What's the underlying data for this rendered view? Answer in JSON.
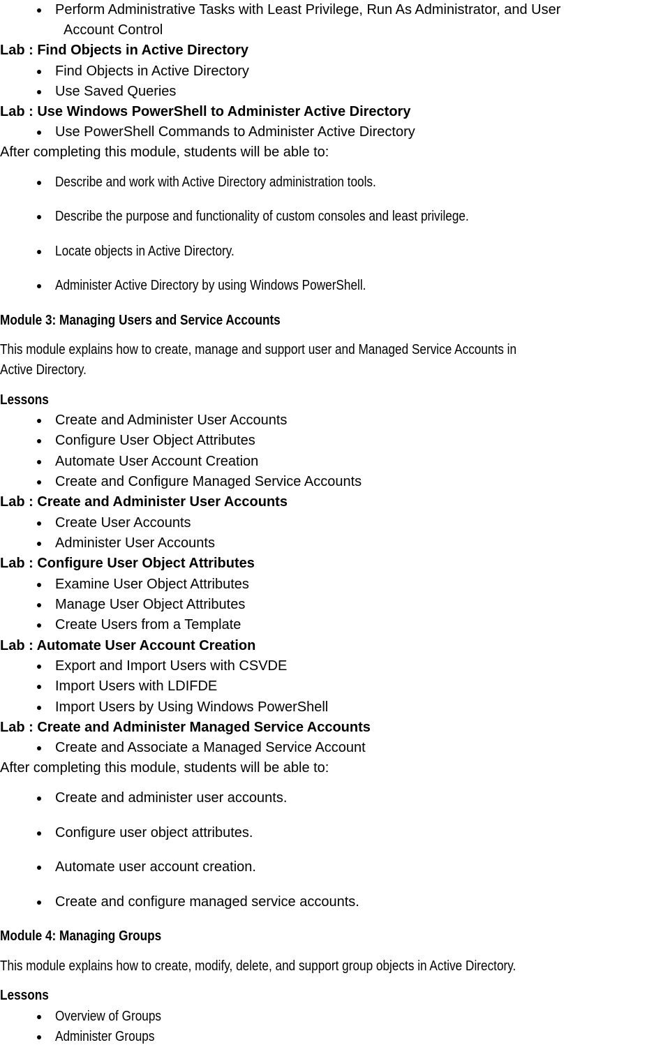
{
  "doc": {
    "top": {
      "continued_bullet": [
        "Perform Administrative Tasks with Least Privilege, Run As Administrator, and User",
        "Account Control"
      ],
      "labs": [
        {
          "title": "Lab : Find Objects in Active Directory",
          "items": [
            "Find Objects in Active Directory",
            "Use Saved Queries"
          ]
        },
        {
          "title": "Lab : Use Windows PowerShell to Administer Active Directory",
          "items": [
            "Use PowerShell Commands to Administer Active Directory"
          ]
        }
      ],
      "outcomes_intro": "After completing this module, students will be able to:",
      "outcomes": [
        "Describe and work with Active Directory administration tools.",
        "Describe the purpose and functionality of custom consoles and least privilege.",
        "Locate objects in Active Directory.",
        "Administer Active Directory by using Windows PowerShell."
      ]
    },
    "module3": {
      "heading": "Module 3: Managing Users and Service Accounts",
      "description": [
        "This module explains how to create, manage and support user and Managed Service Accounts in",
        "Active Directory."
      ],
      "lessons_label": "Lessons",
      "lessons": [
        "Create and Administer User Accounts",
        "Configure User Object Attributes",
        "Automate User Account Creation",
        "Create and Configure Managed Service Accounts"
      ],
      "labs": [
        {
          "title": "Lab : Create and Administer User Accounts",
          "items": [
            "Create User Accounts",
            "Administer User Accounts"
          ]
        },
        {
          "title": "Lab : Configure User Object Attributes",
          "items": [
            "Examine User Object Attributes",
            "Manage User Object Attributes",
            "Create Users from a Template"
          ]
        },
        {
          "title": "Lab : Automate User Account Creation",
          "items": [
            "Export and Import Users with CSVDE",
            "Import Users with LDIFDE",
            "Import Users by Using Windows PowerShell"
          ]
        },
        {
          "title": "Lab : Create and Administer Managed Service Accounts",
          "items": [
            "Create and Associate a Managed Service Account"
          ]
        }
      ],
      "outcomes_intro": "After completing this module, students will be able to:",
      "outcomes": [
        "Create and administer user accounts.",
        "Configure user object attributes.",
        "Automate user account creation.",
        "Create and configure managed service accounts."
      ]
    },
    "module4": {
      "heading": "Module 4: Managing Groups",
      "description": "This module explains how to create, modify, delete, and support group objects in Active Directory.",
      "lessons_label": "Lessons",
      "lessons": [
        "Overview of Groups",
        "Administer Groups"
      ]
    }
  }
}
